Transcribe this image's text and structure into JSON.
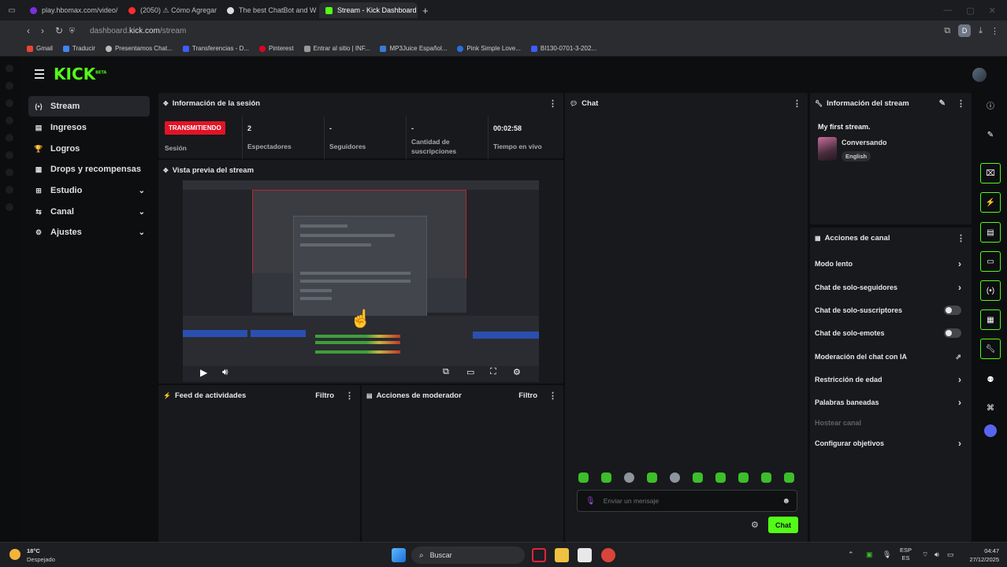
{
  "browser": {
    "tabs": [
      {
        "label": "play.hbomax.com/video/",
        "color": "#7b2fe0",
        "active": false
      },
      {
        "label": "(2050) ⚠ Cómo Agregar",
        "color": "#ff2d2d",
        "active": false
      },
      {
        "label": "The best ChatBot and W",
        "color": "#dddddd",
        "active": false
      },
      {
        "label": "Stream - Kick Dashboard",
        "color": "#53fc18",
        "active": true
      }
    ],
    "new_tab": "+",
    "url_prefix": "dashboard.",
    "url_domain": "kick.com",
    "url_path": "/stream",
    "profile_initial": "D",
    "bookmarks": [
      {
        "label": "Gmail",
        "color": "#ea4335"
      },
      {
        "label": "Traducir",
        "color": "#4285f4"
      },
      {
        "label": "Presentamos Chat...",
        "color": "#bbbbbb"
      },
      {
        "label": "Transferencias - D...",
        "color": "#3f5cff"
      },
      {
        "label": "Pinterest",
        "color": "#e60023"
      },
      {
        "label": "Entrar al sitio | INF...",
        "color": "#999999"
      },
      {
        "label": "MP3Juice Español...",
        "color": "#3a7bd5"
      },
      {
        "label": "Pink Simple Love...",
        "color": "#2a6fdb"
      },
      {
        "label": "BI130-0701-3-202...",
        "color": "#3f5cff"
      }
    ]
  },
  "kick": {
    "logo": "KICK",
    "logo_mark": "BETA"
  },
  "sidebar": {
    "items": [
      {
        "label": "Stream",
        "icon": "(•)",
        "active": true,
        "chevron": false
      },
      {
        "label": "Ingresos",
        "icon": "▤",
        "active": false,
        "chevron": false
      },
      {
        "label": "Logros",
        "icon": "🏆",
        "active": false,
        "chevron": false
      },
      {
        "label": "Drops y recompensas",
        "icon": "▦",
        "active": false,
        "chevron": false
      },
      {
        "label": "Estudio",
        "icon": "⊞",
        "active": false,
        "chevron": true
      },
      {
        "label": "Canal",
        "icon": "⇆",
        "active": false,
        "chevron": true
      },
      {
        "label": "Ajustes",
        "icon": "⚙",
        "active": false,
        "chevron": true
      }
    ]
  },
  "session": {
    "title": "Información de la sesión",
    "status_badge": "TRANSMITIENDO",
    "session_label": "Sesión",
    "stats": [
      {
        "value": "2",
        "label": "Espectadores"
      },
      {
        "value": "-",
        "label": "Seguidores"
      },
      {
        "value": "-",
        "label": "Cantidad de suscripciones"
      },
      {
        "value": "00:02:58",
        "label": "Tiempo en vivo"
      }
    ]
  },
  "preview": {
    "title": "Vista previa del stream"
  },
  "activity": {
    "title": "Feed de actividades",
    "filter": "Filtro"
  },
  "moderator": {
    "title": "Acciones de moderador",
    "filter": "Filtro"
  },
  "chat": {
    "title": "Chat",
    "placeholder": "Enviar un mensaje",
    "send_label": "Chat",
    "accent": "#53fc18"
  },
  "stream_info": {
    "title": "Información del stream",
    "stream_title": "My first stream.",
    "category": "Conversando",
    "tag": "English"
  },
  "channel_actions": {
    "title": "Acciones de canal",
    "items": [
      {
        "label": "Modo lento",
        "control": "chevron"
      },
      {
        "label": "Chat de solo-seguidores",
        "control": "chevron"
      },
      {
        "label": "Chat de solo-suscriptores",
        "control": "toggle"
      },
      {
        "label": "Chat de solo-emotes",
        "control": "toggle"
      },
      {
        "label": "Moderación del chat con IA",
        "control": "external"
      },
      {
        "label": "Restricción de edad",
        "control": "chevron"
      },
      {
        "label": "Palabras baneadas",
        "control": "chevron"
      },
      {
        "label": "Hostear canal",
        "control": "none"
      },
      {
        "label": "Configurar objetivos",
        "control": "chevron"
      }
    ]
  },
  "taskbar": {
    "temperature": "18°C",
    "weather": "Despejado",
    "search": "Buscar",
    "lang_top": "ESP",
    "lang_bottom": "ES",
    "time": "04:47",
    "date": "27/12/2025"
  }
}
